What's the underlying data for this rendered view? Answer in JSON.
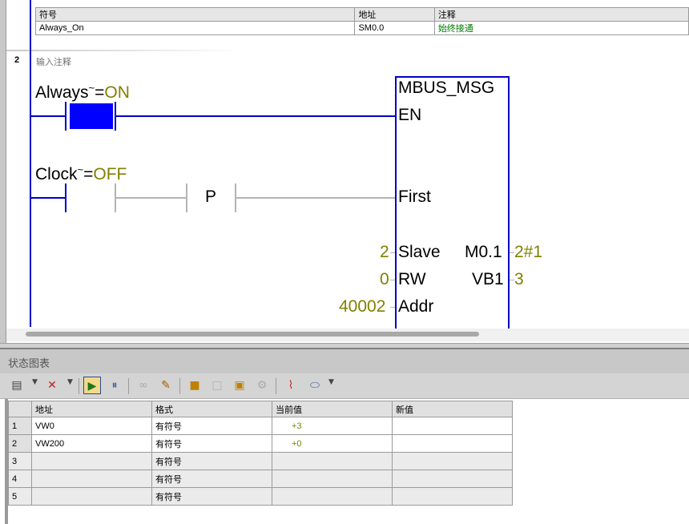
{
  "symbol_table": {
    "headers": {
      "symbol": "符号",
      "address": "地址",
      "comment": "注释"
    },
    "row": {
      "symbol": "Always_On",
      "address": "SM0.0",
      "comment": "始终接通"
    }
  },
  "network": {
    "number": "2",
    "comment_placeholder": "输入注释",
    "contact1": {
      "name": "Always",
      "tilde": "~",
      "eq": "=",
      "state": "ON"
    },
    "contact2": {
      "name": "Clock",
      "tilde": "~",
      "eq": "=",
      "state": "OFF"
    },
    "p_label": "P",
    "block": {
      "title": "MBUS_MSG",
      "in_en": "EN",
      "in_first": "First",
      "in_slave": "Slave",
      "val_slave": "2",
      "in_rw": "RW",
      "val_rw": "0",
      "in_addr": "Addr",
      "val_addr": "40002",
      "out1": "M0.1",
      "out1_val": "2#1",
      "out2": "VB1",
      "out2_val": "3"
    }
  },
  "status_chart": {
    "title": "状态图表",
    "headers": {
      "address": "地址",
      "format": "格式",
      "current": "当前值",
      "new": "新值"
    },
    "rows": [
      {
        "n": "1",
        "address": "VW0",
        "format": "有符号",
        "current": "+3",
        "new": ""
      },
      {
        "n": "2",
        "address": "VW200",
        "format": "有符号",
        "current": "+0",
        "new": ""
      },
      {
        "n": "3",
        "address": "",
        "format": "有符号",
        "current": "",
        "new": ""
      },
      {
        "n": "4",
        "address": "",
        "format": "有符号",
        "current": "",
        "new": ""
      },
      {
        "n": "5",
        "address": "",
        "format": "有符号",
        "current": "",
        "new": ""
      }
    ]
  },
  "colors": {
    "rail": "#0000c8",
    "olive": "#808000",
    "grey_wire": "#b4b4b4",
    "value_green": "#6b8a00"
  }
}
